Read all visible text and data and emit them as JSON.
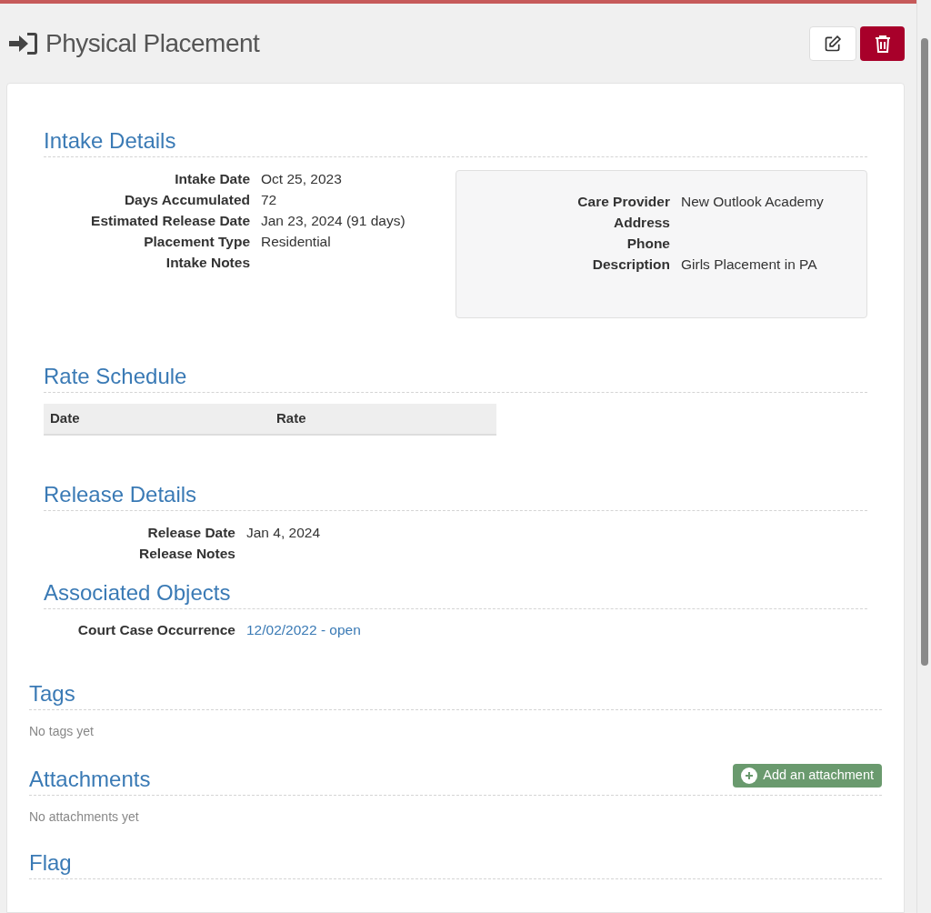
{
  "header": {
    "title": "Physical Placement",
    "actions": [
      {
        "kind": "edit"
      },
      {
        "kind": "delete"
      }
    ]
  },
  "intake": {
    "heading": "Intake Details",
    "fields": [
      {
        "label": "Intake Date",
        "value": "Oct 25, 2023"
      },
      {
        "label": "Days Accumulated",
        "value": "72"
      },
      {
        "label": "Estimated Release Date",
        "value": "Jan 23, 2024 (91 days)"
      },
      {
        "label": "Placement Type",
        "value": "Residential"
      },
      {
        "label": "Intake Notes"
      }
    ],
    "provider": [
      {
        "label": "Care Provider",
        "value": "New Outlook Academy"
      },
      {
        "label": "Address"
      },
      {
        "label": "Phone"
      },
      {
        "label": "Description",
        "value": "Girls Placement in PA"
      }
    ]
  },
  "rate_schedule": {
    "heading": "Rate Schedule",
    "columns": [
      "Date",
      "Rate"
    ]
  },
  "release": {
    "heading": "Release Details",
    "fields": [
      {
        "label": "Release Date",
        "value": "Jan 4, 2024"
      },
      {
        "label": "Release Notes"
      }
    ]
  },
  "associated": {
    "heading": "Associated Objects",
    "fields": [
      {
        "label": "Court Case Occurrence",
        "link": "12/02/2022 - open"
      }
    ]
  },
  "tags": {
    "heading": "Tags",
    "empty": "No tags yet"
  },
  "attachments": {
    "heading": "Attachments",
    "button": "Add an attachment",
    "empty": "No attachments yet"
  },
  "flag": {
    "heading": "Flag"
  }
}
